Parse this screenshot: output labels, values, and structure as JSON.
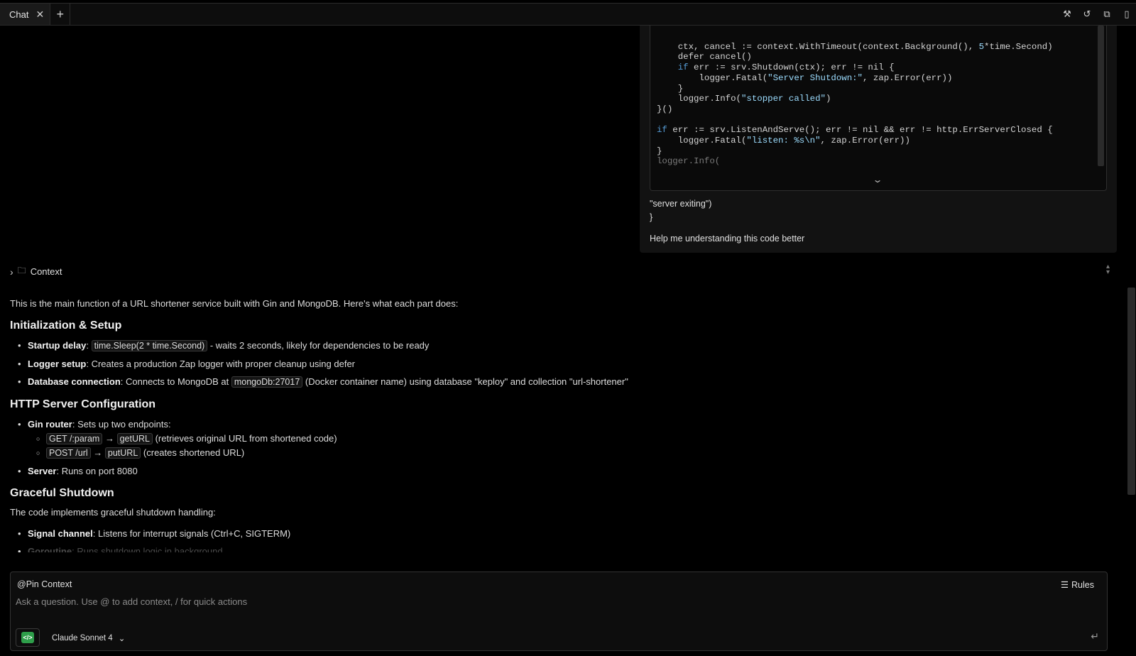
{
  "tabbar": {
    "tab_label": "Chat",
    "close_glyph": "✕",
    "new_tab_glyph": "+",
    "actions": [
      {
        "name": "tools-icon",
        "glyph": "⚒"
      },
      {
        "name": "history-icon",
        "glyph": "↺"
      },
      {
        "name": "open-external-icon",
        "glyph": "⧉"
      },
      {
        "name": "document-icon",
        "glyph": "▯"
      }
    ]
  },
  "user_message": {
    "code_lines": [
      "    ctx, cancel := context.WithTimeout(context.Background(), 5*time.Second)",
      "    defer cancel()",
      "    if err := srv.Shutdown(ctx); err != nil {",
      "        logger.Fatal(\"Server Shutdown:\", zap.Error(err))",
      "    }",
      "    logger.Info(\"stopper called\")",
      "}()",
      "",
      "if err := srv.ListenAndServe(); err != nil && err != http.ErrServerClosed {",
      "    logger.Fatal(\"listen: %s\\n\", zap.Error(err))",
      "}",
      "logger.Info("
    ],
    "tail_line_1": "\"server exiting\")",
    "tail_line_2": "}",
    "question": "Help me understanding this code better"
  },
  "context": {
    "label": "Context"
  },
  "answer": {
    "intro": "This is the main function of a URL shortener service built with Gin and MongoDB. Here's what each part does:",
    "section1": {
      "heading": "Initialization & Setup",
      "startup_label": "Startup delay",
      "startup_code": "time.Sleep(2 * time.Second)",
      "startup_text": " - waits 2 seconds, likely for dependencies to be ready",
      "logger_label": "Logger setup",
      "logger_text": ": Creates a production Zap logger with proper cleanup using defer",
      "db_label": "Database connection",
      "db_text_1": ": Connects to MongoDB at ",
      "db_code": "mongoDb:27017",
      "db_text_2": " (Docker container name) using database \"keploy\" and collection \"url-shortener\""
    },
    "section2": {
      "heading": "HTTP Server Configuration",
      "router_label": "Gin router",
      "router_text": ": Sets up two endpoints:",
      "route1_method": "GET /:param",
      "route1_handler": "getURL",
      "route1_text": " (retrieves original URL from shortened code)",
      "route2_method": "POST /url",
      "route2_handler": "putURL",
      "route2_text": " (creates shortened URL)",
      "arrow": "→",
      "server_label": "Server",
      "server_text": ": Runs on port 8080"
    },
    "section3": {
      "heading": "Graceful Shutdown",
      "intro": "The code implements graceful shutdown handling:",
      "signal_label": "Signal channel",
      "signal_text": ": Listens for interrupt signals (Ctrl+C, SIGTERM)",
      "goroutine_label": "Goroutine",
      "goroutine_text": ": Runs shutdown logic in background"
    }
  },
  "input": {
    "pin_label": "@Pin Context",
    "rules_label": "Rules",
    "placeholder": "Ask a question. Use @ to add context, / for quick actions",
    "model_name": "Claude Sonnet 4",
    "model_icon_text": "</>",
    "enter_glyph": "↵"
  },
  "colors": {
    "background": "#000000",
    "model_badge": "#2e9e4a",
    "keyword": "#569cd6"
  }
}
